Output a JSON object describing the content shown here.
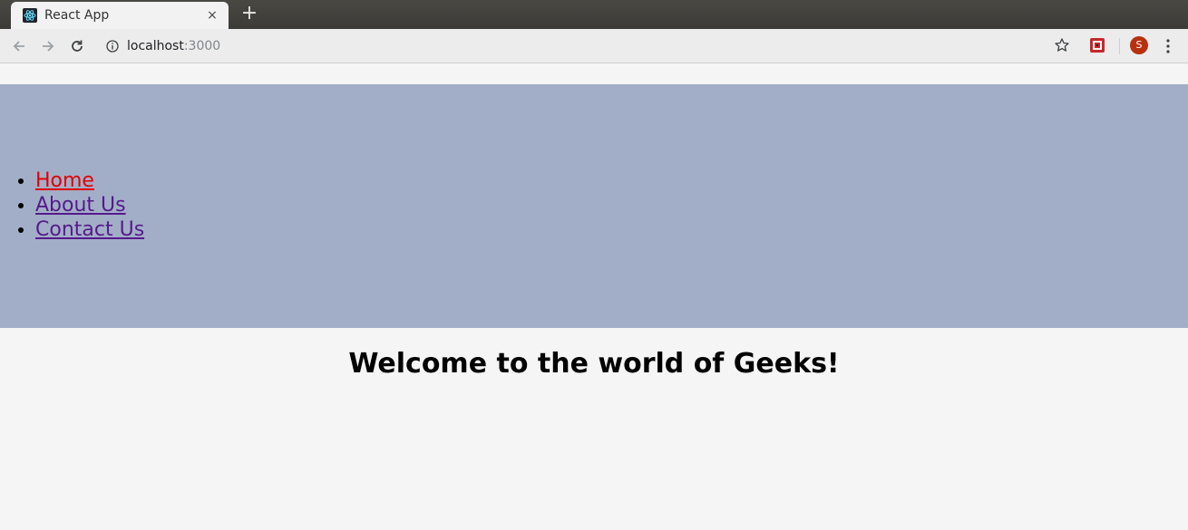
{
  "browser": {
    "tab": {
      "title": "React App",
      "favicon": "react-logo-icon",
      "close_glyph": "×"
    },
    "new_tab_glyph": "+",
    "toolbar": {
      "back_icon": "arrow-left-icon",
      "forward_icon": "arrow-right-icon",
      "reload_icon": "reload-icon",
      "site_info_icon": "info-icon",
      "url_host": "localhost",
      "url_port": ":3000",
      "bookmark_icon": "star-icon",
      "extension_icon": "extension-icon",
      "profile_initial": "S",
      "menu_icon": "kebab-menu-icon"
    }
  },
  "page": {
    "nav": {
      "items": [
        {
          "label": "Home",
          "state": "active"
        },
        {
          "label": "About Us",
          "state": "visited"
        },
        {
          "label": "Contact Us",
          "state": "visited"
        }
      ]
    },
    "heading": "Welcome to the world of Geeks!"
  },
  "colors": {
    "nav_background": "#a2aec7",
    "page_background": "#f5f5f5",
    "active_link": "#e00000",
    "visited_link": "#551a8b",
    "avatar": "#b7310f"
  }
}
